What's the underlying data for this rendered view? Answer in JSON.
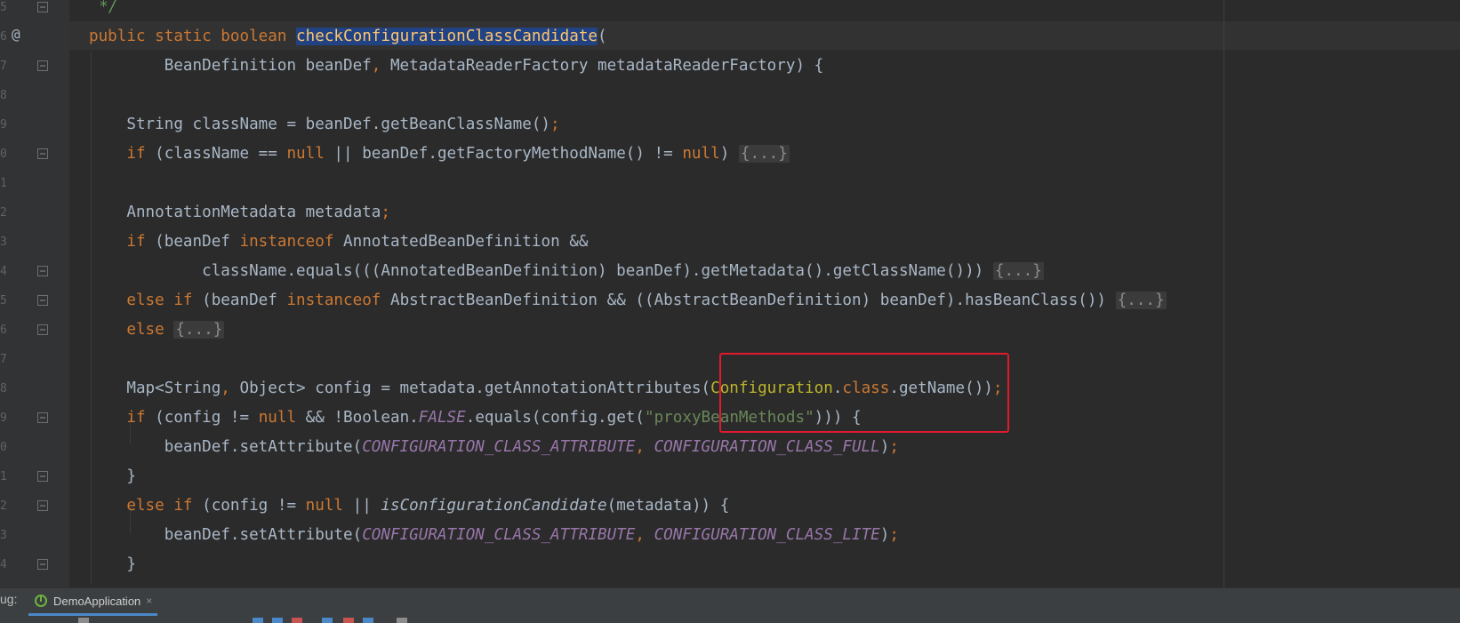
{
  "editor": {
    "code_lines": [
      {
        "indent": 8,
        "segments": [
          {
            "t": "*/",
            "c": "cm"
          }
        ]
      },
      {
        "indent": 0,
        "segments": [
          {
            "t": "public static boolean ",
            "c": "kw"
          },
          {
            "t": "checkConfigurationClassCandidate",
            "c": "sel"
          },
          {
            "t": "(",
            "c": "cl"
          }
        ]
      },
      {
        "indent": 0,
        "segments": [
          {
            "t": "        BeanDefinition beanDef",
            "c": "cl"
          },
          {
            "t": ", ",
            "c": "kw"
          },
          {
            "t": "MetadataReaderFactory metadataReaderFactory) {",
            "c": "cl"
          }
        ]
      },
      {
        "indent": 0,
        "segments": []
      },
      {
        "indent": 0,
        "segments": [
          {
            "t": "    String className = beanDef.getBeanClassName()",
            "c": "cl"
          },
          {
            "t": ";",
            "c": "kw"
          }
        ]
      },
      {
        "indent": 0,
        "segments": [
          {
            "t": "    if ",
            "c": "kw"
          },
          {
            "t": "(className == ",
            "c": "cl"
          },
          {
            "t": "null ",
            "c": "kw"
          },
          {
            "t": "|| beanDef.getFactoryMethodName() != ",
            "c": "cl"
          },
          {
            "t": "null",
            "c": "kw"
          },
          {
            "t": ") ",
            "c": "cl"
          },
          {
            "t": "{...}",
            "c": "foldtext"
          }
        ]
      },
      {
        "indent": 0,
        "segments": []
      },
      {
        "indent": 0,
        "segments": [
          {
            "t": "    AnnotationMetadata metadata",
            "c": "cl"
          },
          {
            "t": ";",
            "c": "kw"
          }
        ]
      },
      {
        "indent": 0,
        "segments": [
          {
            "t": "    if ",
            "c": "kw"
          },
          {
            "t": "(beanDef ",
            "c": "cl"
          },
          {
            "t": "instanceof ",
            "c": "kw"
          },
          {
            "t": "AnnotatedBeanDefinition &&",
            "c": "cl"
          }
        ]
      },
      {
        "indent": 0,
        "segments": [
          {
            "t": "            className.equals(((AnnotatedBeanDefinition) beanDef).getMetadata().getClassName())) ",
            "c": "cl"
          },
          {
            "t": "{...}",
            "c": "foldtext"
          }
        ]
      },
      {
        "indent": 0,
        "segments": [
          {
            "t": "    else if ",
            "c": "kw"
          },
          {
            "t": "(beanDef ",
            "c": "cl"
          },
          {
            "t": "instanceof ",
            "c": "kw"
          },
          {
            "t": "AbstractBeanDefinition && ((AbstractBeanDefinition) beanDef).hasBeanClass()) ",
            "c": "cl"
          },
          {
            "t": "{...}",
            "c": "foldtext"
          }
        ]
      },
      {
        "indent": 0,
        "segments": [
          {
            "t": "    else ",
            "c": "kw"
          },
          {
            "t": "{...}",
            "c": "foldtext"
          }
        ]
      },
      {
        "indent": 0,
        "segments": []
      },
      {
        "indent": 0,
        "segments": [
          {
            "t": "    Map<String",
            "c": "cl"
          },
          {
            "t": ", ",
            "c": "kw"
          },
          {
            "t": "Object> config = metadata.getAnnotationAttributes(",
            "c": "cl"
          },
          {
            "t": "Configuration",
            "c": "ann"
          },
          {
            "t": ".",
            "c": "cl"
          },
          {
            "t": "class",
            "c": "kw"
          },
          {
            "t": ".getName())",
            "c": "cl"
          },
          {
            "t": ";",
            "c": "kw"
          }
        ]
      },
      {
        "indent": 0,
        "segments": [
          {
            "t": "    if ",
            "c": "kw"
          },
          {
            "t": "(config != ",
            "c": "cl"
          },
          {
            "t": "null ",
            "c": "kw"
          },
          {
            "t": "&& !Boolean.",
            "c": "cl"
          },
          {
            "t": "FALSE",
            "c": "cst"
          },
          {
            "t": ".equals(config.get(",
            "c": "cl"
          },
          {
            "t": "\"proxyBeanMethods\"",
            "c": "st"
          },
          {
            "t": "))) {",
            "c": "cl"
          }
        ]
      },
      {
        "indent": 0,
        "segments": [
          {
            "t": "        beanDef.setAttribute(",
            "c": "cl"
          },
          {
            "t": "CONFIGURATION_CLASS_ATTRIBUTE",
            "c": "cst"
          },
          {
            "t": ", ",
            "c": "kw"
          },
          {
            "t": "CONFIGURATION_CLASS_FULL",
            "c": "cst"
          },
          {
            "t": ")",
            "c": "cl"
          },
          {
            "t": ";",
            "c": "kw"
          }
        ]
      },
      {
        "indent": 0,
        "segments": [
          {
            "t": "    }",
            "c": "cl"
          }
        ]
      },
      {
        "indent": 0,
        "segments": [
          {
            "t": "    else if ",
            "c": "kw"
          },
          {
            "t": "(config != ",
            "c": "cl"
          },
          {
            "t": "null ",
            "c": "kw"
          },
          {
            "t": "|| ",
            "c": "cl"
          },
          {
            "t": "isConfigurationCandidate",
            "c": "itl"
          },
          {
            "t": "(metadata)) {",
            "c": "cl"
          }
        ]
      },
      {
        "indent": 0,
        "segments": [
          {
            "t": "        beanDef.setAttribute(",
            "c": "cl"
          },
          {
            "t": "CONFIGURATION_CLASS_ATTRIBUTE",
            "c": "cst"
          },
          {
            "t": ", ",
            "c": "kw"
          },
          {
            "t": "CONFIGURATION_CLASS_LITE",
            "c": "cst"
          },
          {
            "t": ")",
            "c": "cl"
          },
          {
            "t": ";",
            "c": "kw"
          }
        ]
      },
      {
        "indent": 0,
        "segments": [
          {
            "t": "    }",
            "c": "cl"
          }
        ]
      }
    ],
    "gutter_numbers": [
      "5",
      "6",
      "7",
      "8",
      "9",
      "0",
      "1",
      "2",
      "3",
      "4",
      "5",
      "6",
      "7",
      "8",
      "9",
      "0",
      "1",
      "2",
      "3",
      "4"
    ],
    "gutter_icon": "@"
  },
  "debug_bar": {
    "label": "ug:",
    "tab_label": "DemoApplication",
    "close_glyph": "×"
  },
  "colors": {
    "editor_bg": "#2b2b2b",
    "keyword": "#cc7832",
    "method": "#ffc66d",
    "string": "#6a8759",
    "constant": "#9876aa",
    "selection": "#214283",
    "annotation_box": "#e2192e"
  }
}
